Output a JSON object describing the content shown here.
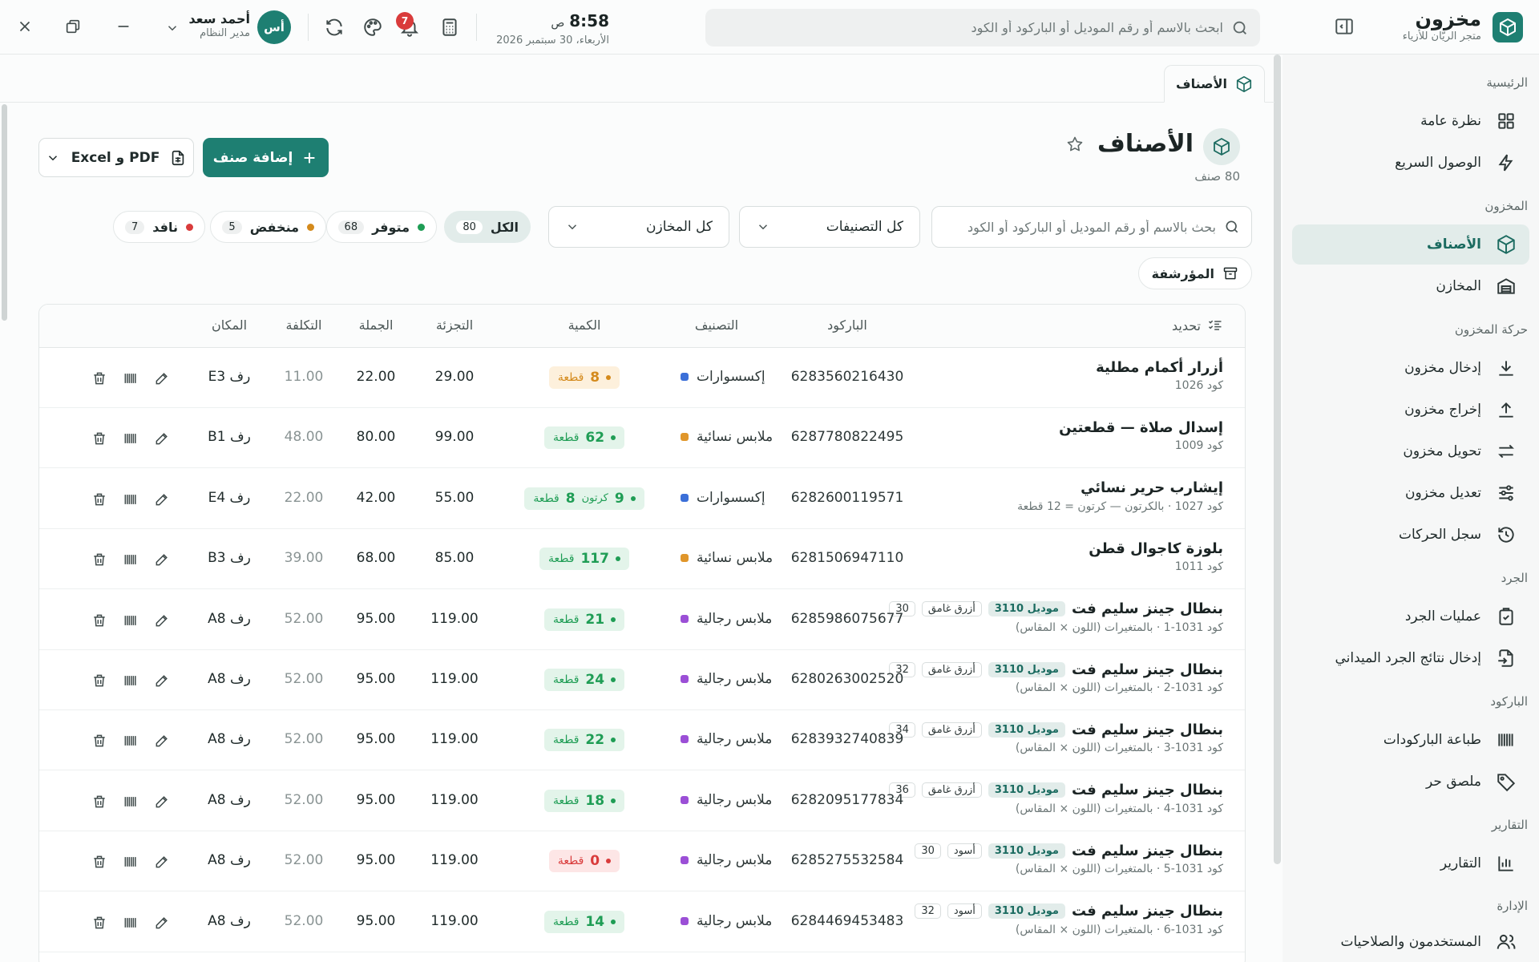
{
  "header": {
    "brand_title": "مخزون",
    "brand_subtitle": "متجر الريّان للأزياء",
    "search_placeholder": "ابحث بالاسم أو رقم الموديل أو الباركود أو الكود",
    "time": "8:58",
    "ampm": "ص",
    "date": "الأربعاء، 30 سبتمبر 2026",
    "notifications_count": "7",
    "user_initials": "أس",
    "user_name": "أحمد سعد",
    "user_role": "مدير النظام"
  },
  "sidebar": {
    "sections": [
      {
        "title": "الرئيسية"
      },
      {
        "title": "المخزون"
      },
      {
        "title": "حركة المخزون"
      },
      {
        "title": "الجرد"
      },
      {
        "title": "الباركود"
      },
      {
        "title": "التقارير"
      },
      {
        "title": "الإدارة"
      }
    ],
    "items": [
      {
        "label": "نظرة عامة",
        "icon": "grid-icon"
      },
      {
        "label": "الوصول السريع",
        "icon": "bolt-icon"
      },
      {
        "label": "الأصناف",
        "icon": "box-icon",
        "active": true
      },
      {
        "label": "المخازن",
        "icon": "warehouse-icon"
      },
      {
        "label": "إدخال مخزون",
        "icon": "download-icon"
      },
      {
        "label": "إخراج مخزون",
        "icon": "upload-icon"
      },
      {
        "label": "تحويل مخزون",
        "icon": "transfer-icon"
      },
      {
        "label": "تعديل مخزون",
        "icon": "sliders-icon"
      },
      {
        "label": "سجل الحركات",
        "icon": "history-icon"
      },
      {
        "label": "عمليات الجرد",
        "icon": "clipboard-icon"
      },
      {
        "label": "إدخال نتائج الجرد الميداني",
        "icon": "file-import-icon"
      },
      {
        "label": "طباعة الباركودات",
        "icon": "barcode-icon"
      },
      {
        "label": "ملصق حر",
        "icon": "tag-icon"
      },
      {
        "label": "التقارير",
        "icon": "chart-icon"
      },
      {
        "label": "المستخدمون والصلاحيات",
        "icon": "users-icon"
      }
    ]
  },
  "tab": {
    "label": "الأصناف"
  },
  "page": {
    "title": "الأصناف",
    "count": "80 صنف",
    "add_button": "إضافة صنف",
    "export_button": "Excel و PDF"
  },
  "filters": {
    "search_placeholder": "بحث بالاسم أو رقم الموديل أو الباركود أو الكود",
    "category_select": "كل التصنيفات",
    "warehouse_select": "كل المخازن",
    "archived_label": "المؤرشفة",
    "chips": [
      {
        "label": "الكل",
        "count": "80",
        "color": ""
      },
      {
        "label": "متوفر",
        "count": "68",
        "color": "#1f9d55"
      },
      {
        "label": "منخفض",
        "count": "5",
        "color": "#d48a1c"
      },
      {
        "label": "نافد",
        "count": "7",
        "color": "#d93b3b"
      }
    ]
  },
  "table": {
    "headers": {
      "select": "تحديد",
      "barcode": "الباركود",
      "category": "التصنيف",
      "quantity": "الكمية",
      "retail": "التجزئة",
      "wholesale": "الجملة",
      "cost": "التكلفة",
      "location": "المكان"
    },
    "rows": [
      {
        "name": "أزرار أكمام مطلية",
        "model": "",
        "color": "",
        "size": "",
        "sub": "كود 1026",
        "barcode": "6283560216430",
        "category": "إكسسوارات",
        "cat_color": "#3b6fd8",
        "qty": "8",
        "qty_unit": "قطعة",
        "qty_carton": "",
        "qty_carton_unit": "",
        "status": "low",
        "retail": "29.00",
        "wholesale": "22.00",
        "cost": "11.00",
        "location": "رف E3"
      },
      {
        "name": "إسدال صلاة — قطعتين",
        "model": "",
        "color": "",
        "size": "",
        "sub": "كود 1009",
        "barcode": "6287780822495",
        "category": "ملابس نسائية",
        "cat_color": "#e0962a",
        "qty": "62",
        "qty_unit": "قطعة",
        "qty_carton": "",
        "qty_carton_unit": "",
        "status": "ok",
        "retail": "99.00",
        "wholesale": "80.00",
        "cost": "48.00",
        "location": "رف B1"
      },
      {
        "name": "إيشارب حرير نسائي",
        "model": "",
        "color": "",
        "size": "",
        "sub": "كود 1027 · بالكرتون — كرتون = 12 قطعة",
        "barcode": "6282600119571",
        "category": "إكسسوارات",
        "cat_color": "#3b6fd8",
        "qty": "8",
        "qty_unit": "قطعة",
        "qty_carton": "9",
        "qty_carton_unit": "كرتون",
        "status": "ok",
        "retail": "55.00",
        "wholesale": "42.00",
        "cost": "22.00",
        "location": "رف E4"
      },
      {
        "name": "بلوزة كاجوال قطن",
        "model": "",
        "color": "",
        "size": "",
        "sub": "كود 1011",
        "barcode": "6281506947110",
        "category": "ملابس نسائية",
        "cat_color": "#e0962a",
        "qty": "117",
        "qty_unit": "قطعة",
        "qty_carton": "",
        "qty_carton_unit": "",
        "status": "ok",
        "retail": "85.00",
        "wholesale": "68.00",
        "cost": "39.00",
        "location": "رف B3"
      },
      {
        "name": "بنطال جينز سليم فت",
        "model": "موديل 3110",
        "color": "أزرق غامق",
        "size": "30",
        "sub": "كود 1031-1 · بالمتغيرات (اللون × المقاس)",
        "barcode": "6285986075677",
        "category": "ملابس رجالية",
        "cat_color": "#9b4fd6",
        "qty": "21",
        "qty_unit": "قطعة",
        "qty_carton": "",
        "qty_carton_unit": "",
        "status": "ok",
        "retail": "119.00",
        "wholesale": "95.00",
        "cost": "52.00",
        "location": "رف A8"
      },
      {
        "name": "بنطال جينز سليم فت",
        "model": "موديل 3110",
        "color": "أزرق غامق",
        "size": "32",
        "sub": "كود 1031-2 · بالمتغيرات (اللون × المقاس)",
        "barcode": "6280263002520",
        "category": "ملابس رجالية",
        "cat_color": "#9b4fd6",
        "qty": "24",
        "qty_unit": "قطعة",
        "qty_carton": "",
        "qty_carton_unit": "",
        "status": "ok",
        "retail": "119.00",
        "wholesale": "95.00",
        "cost": "52.00",
        "location": "رف A8"
      },
      {
        "name": "بنطال جينز سليم فت",
        "model": "موديل 3110",
        "color": "أزرق غامق",
        "size": "34",
        "sub": "كود 1031-3 · بالمتغيرات (اللون × المقاس)",
        "barcode": "6283932740839",
        "category": "ملابس رجالية",
        "cat_color": "#9b4fd6",
        "qty": "22",
        "qty_unit": "قطعة",
        "qty_carton": "",
        "qty_carton_unit": "",
        "status": "ok",
        "retail": "119.00",
        "wholesale": "95.00",
        "cost": "52.00",
        "location": "رف A8"
      },
      {
        "name": "بنطال جينز سليم فت",
        "model": "موديل 3110",
        "color": "أزرق غامق",
        "size": "36",
        "sub": "كود 1031-4 · بالمتغيرات (اللون × المقاس)",
        "barcode": "6282095177834",
        "category": "ملابس رجالية",
        "cat_color": "#9b4fd6",
        "qty": "18",
        "qty_unit": "قطعة",
        "qty_carton": "",
        "qty_carton_unit": "",
        "status": "ok",
        "retail": "119.00",
        "wholesale": "95.00",
        "cost": "52.00",
        "location": "رف A8"
      },
      {
        "name": "بنطال جينز سليم فت",
        "model": "موديل 3110",
        "color": "أسود",
        "size": "30",
        "sub": "كود 1031-5 · بالمتغيرات (اللون × المقاس)",
        "barcode": "6285275532584",
        "category": "ملابس رجالية",
        "cat_color": "#9b4fd6",
        "qty": "0",
        "qty_unit": "قطعة",
        "qty_carton": "",
        "qty_carton_unit": "",
        "status": "out",
        "retail": "119.00",
        "wholesale": "95.00",
        "cost": "52.00",
        "location": "رف A8"
      },
      {
        "name": "بنطال جينز سليم فت",
        "model": "موديل 3110",
        "color": "أسود",
        "size": "32",
        "sub": "كود 1031-6 · بالمتغيرات (اللون × المقاس)",
        "barcode": "6284469453483",
        "category": "ملابس رجالية",
        "cat_color": "#9b4fd6",
        "qty": "14",
        "qty_unit": "قطعة",
        "qty_carton": "",
        "qty_carton_unit": "",
        "status": "ok",
        "retail": "119.00",
        "wholesale": "95.00",
        "cost": "52.00",
        "location": "رف A8"
      }
    ]
  },
  "colors": {
    "accent": "#1e7f72",
    "accent_soft": "#e2ecea",
    "ok": "#1f9d55",
    "ok_bg": "#e3f4ea",
    "low": "#d48a1c",
    "low_bg": "#fdf0dc",
    "out": "#d93b3b",
    "out_bg": "#fde6e6"
  }
}
